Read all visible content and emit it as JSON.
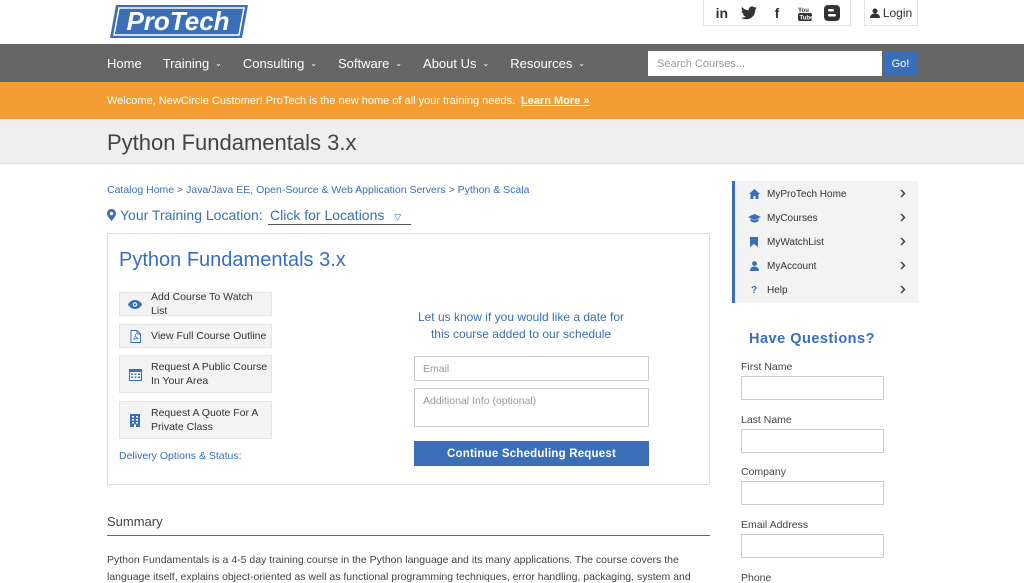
{
  "brand": {
    "logo_text": "ProTech"
  },
  "header": {
    "social": [
      "linkedin-icon",
      "twitter-icon",
      "facebook-icon",
      "youtube-icon",
      "blogger-icon"
    ],
    "login_label": "Login"
  },
  "nav": {
    "items": [
      {
        "label": "Home",
        "dropdown": false
      },
      {
        "label": "Training",
        "dropdown": true
      },
      {
        "label": "Consulting",
        "dropdown": true
      },
      {
        "label": "Software",
        "dropdown": true
      },
      {
        "label": "About Us",
        "dropdown": true
      },
      {
        "label": "Resources",
        "dropdown": true
      }
    ],
    "search_placeholder": "Search Courses...",
    "search_button": "Go!"
  },
  "banner": {
    "message": "Welcome, NewCircle Customer! ProTech is the new home of all your training needs.",
    "link": "Learn More »"
  },
  "page": {
    "title": "Python Fundamentals 3.x"
  },
  "breadcrumb": {
    "items": [
      "Catalog Home",
      "Java/Java EE, Open-Source & Web Application Servers",
      "Python & Scala"
    ],
    "separator": ">"
  },
  "location": {
    "label": "Your Training Location:",
    "button": "Click for Locations"
  },
  "course": {
    "title": "Python Fundamentals 3.x",
    "actions": [
      {
        "icon": "eye-icon",
        "label": "Add Course To Watch List"
      },
      {
        "icon": "pdf-icon",
        "label": "View Full Course Outline"
      },
      {
        "icon": "calendar-icon",
        "label": "Request A Public Course In Your Area"
      },
      {
        "icon": "building-icon",
        "label": "Request A Quote For A Private Class"
      }
    ],
    "delivery_link": "Delivery Options & Status:",
    "schedule_prompt": "Let us know if you would like a date for this course added to our schedule",
    "email_placeholder": "Email",
    "info_placeholder": "Additional Info (optional)",
    "submit_label": "Continue Scheduling Request"
  },
  "summary": {
    "heading": "Summary",
    "text": "Python Fundamentals is a 4-5 day training course in the Python language and its many applications. The course covers the language itself, explains object-oriented as well as functional programming techniques, error handling, packaging, system and"
  },
  "sidebar": {
    "items": [
      {
        "icon": "home-icon",
        "label": "MyProTech Home"
      },
      {
        "icon": "graduation-cap-icon",
        "label": "MyCourses"
      },
      {
        "icon": "bookmark-icon",
        "label": "MyWatchList"
      },
      {
        "icon": "user-icon",
        "label": "MyAccount"
      },
      {
        "icon": "question-icon",
        "label": "Help"
      }
    ]
  },
  "questions": {
    "title": "Have Questions?",
    "fields": [
      "First Name",
      "Last Name",
      "Company",
      "Email Address",
      "Phone"
    ]
  },
  "colors": {
    "accent": "#3a6fb7",
    "banner": "#f29e33",
    "nav": "#666666"
  }
}
